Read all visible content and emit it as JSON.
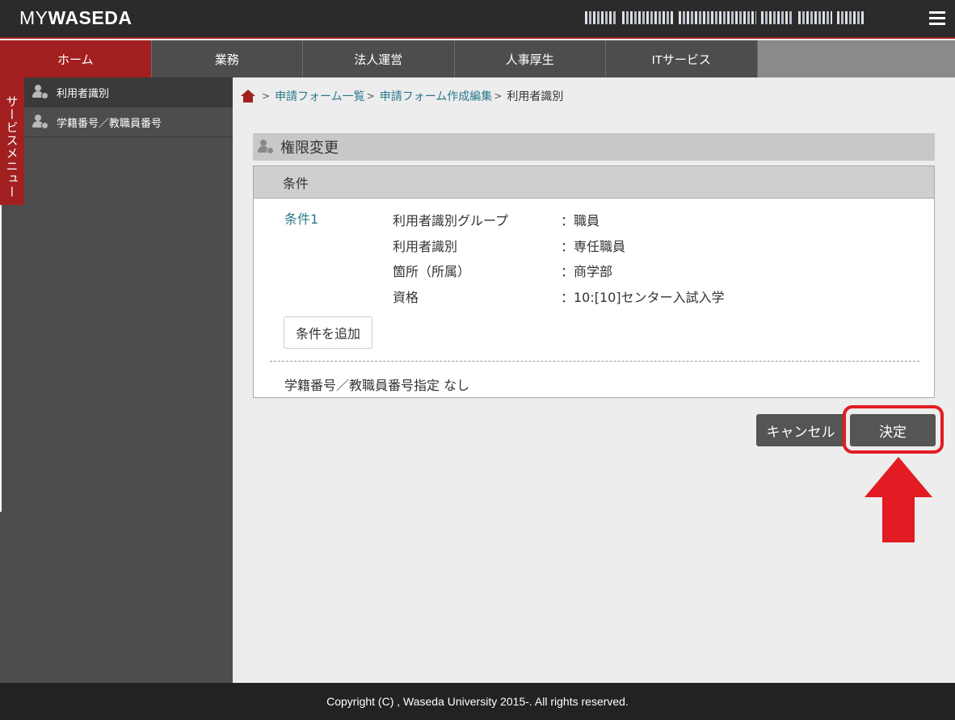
{
  "header": {
    "logo_my": "MY",
    "logo_waseda": "WASEDA"
  },
  "nav": {
    "tabs": [
      {
        "label": "ホーム",
        "active": true
      },
      {
        "label": "業務",
        "active": false
      },
      {
        "label": "法人運営",
        "active": false
      },
      {
        "label": "人事厚生",
        "active": false
      },
      {
        "label": "ITサービス",
        "active": false
      }
    ]
  },
  "sidebar": {
    "service_menu": "サービスメニュー",
    "items": [
      {
        "label": "利用者識別",
        "icon": "user-check-icon",
        "active": true
      },
      {
        "label": "学籍番号／教職員番号",
        "icon": "user-check-icon",
        "active": false
      }
    ]
  },
  "breadcrumb": {
    "items": [
      "申請フォーム一覧",
      "申請フォーム作成編集"
    ],
    "current": "利用者識別",
    "separator": ">"
  },
  "panel": {
    "title": "権限変更",
    "section_title": "条件",
    "condition_label": "条件1",
    "conditions": [
      {
        "key": "利用者識別グループ",
        "value": "：職員"
      },
      {
        "key": "利用者識別",
        "value": "：専任職員"
      },
      {
        "key": "箇所（所属）",
        "value": "：商学部"
      },
      {
        "key": "資格",
        "value": "：10:[10]センター入試入学"
      }
    ],
    "add_button": "条件を追加",
    "student_note": "学籍番号／教職員番号指定 なし"
  },
  "actions": {
    "cancel": "キャンセル",
    "decide": "決定"
  },
  "footer": {
    "copyright": "Copyright (C) , Waseda University 2015-. All rights reserved."
  },
  "colors": {
    "accent": "#a32020",
    "header_bg": "#2b2b2b",
    "link": "#2a7a8a",
    "annotation": "#e31b23"
  }
}
